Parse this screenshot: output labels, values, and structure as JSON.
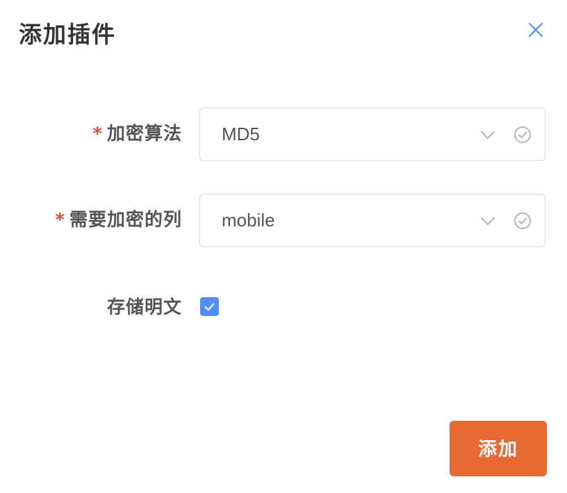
{
  "dialog": {
    "title": "添加插件",
    "close_icon": "close-icon"
  },
  "form": {
    "algorithm": {
      "required_mark": "*",
      "label": "加密算法",
      "value": "MD5",
      "icons": [
        "chevron-down-icon",
        "check-circle-icon"
      ]
    },
    "column": {
      "required_mark": "*",
      "label": "需要加密的列",
      "value": "mobile",
      "icons": [
        "chevron-down-icon",
        "check-circle-icon"
      ]
    },
    "store_plaintext": {
      "label": "存储明文",
      "checked": true
    }
  },
  "footer": {
    "add_label": "添加"
  },
  "colors": {
    "accent": "#e86a32",
    "checkbox": "#4f8ff7",
    "required": "#e0503c",
    "close": "#4f8ff7"
  }
}
